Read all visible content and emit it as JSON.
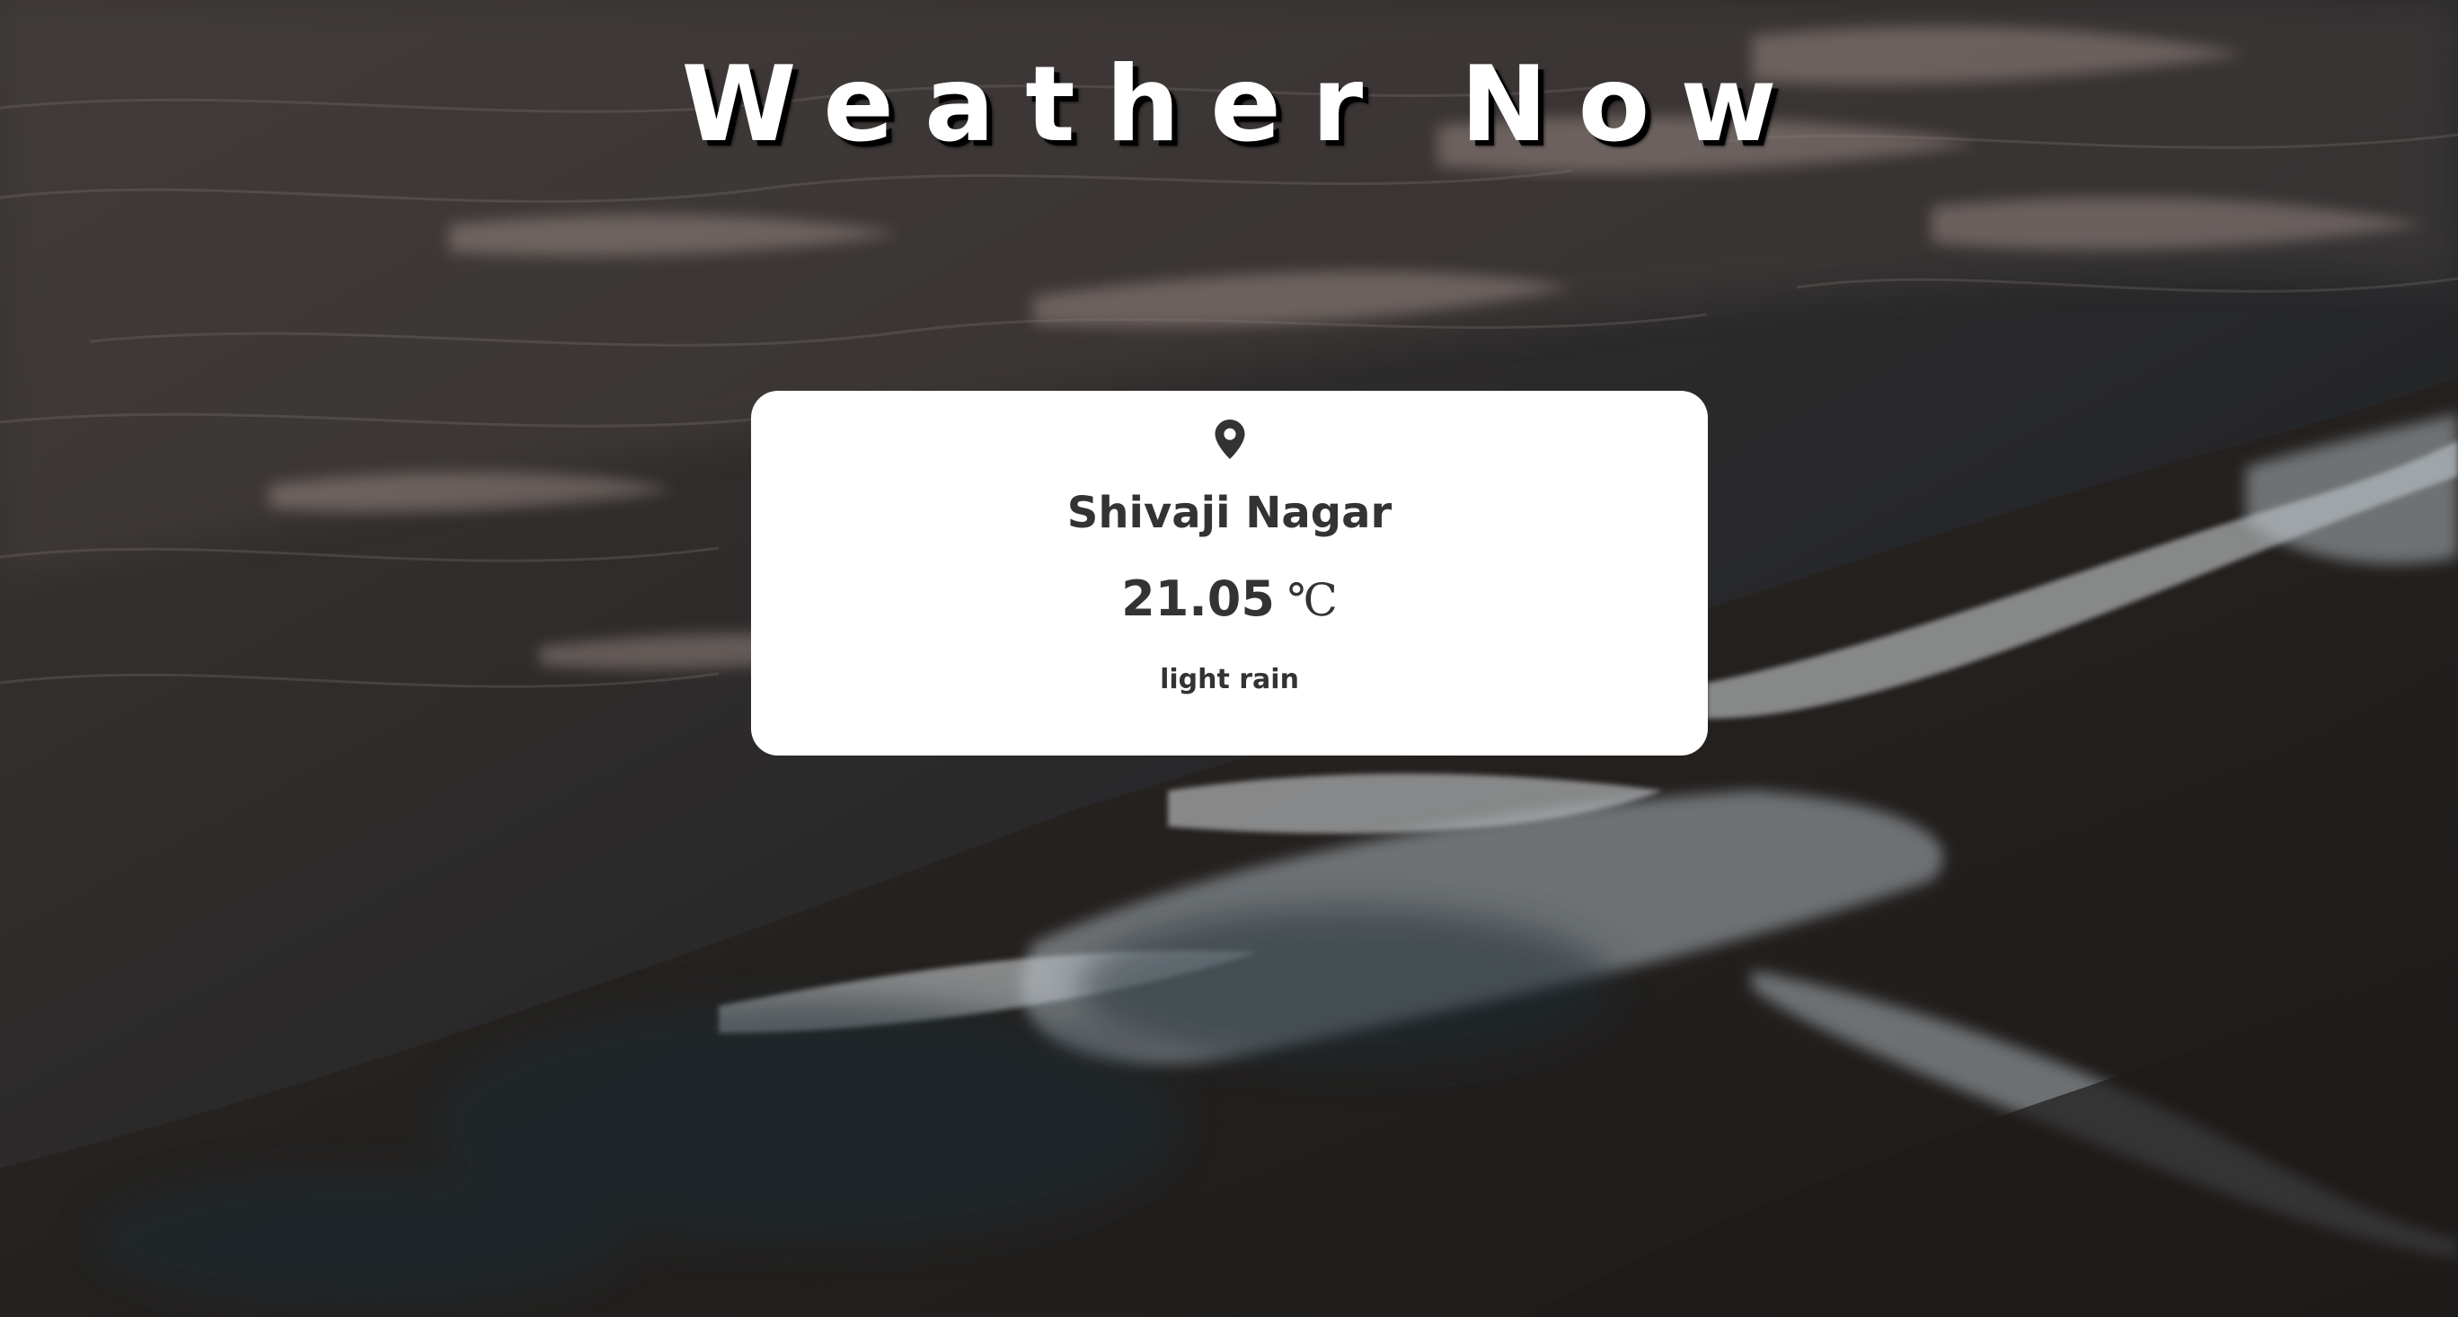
{
  "page": {
    "title": "Weather Now"
  },
  "weather": {
    "location_icon": "location-pin-icon",
    "location": "Shivaji Nagar",
    "temperature": "21.05",
    "unit": "℃",
    "description": "light rain"
  },
  "colors": {
    "card_background": "#ffffff",
    "card_text": "#333333",
    "title_text": "#ffffff",
    "title_shadow": "#000000"
  }
}
